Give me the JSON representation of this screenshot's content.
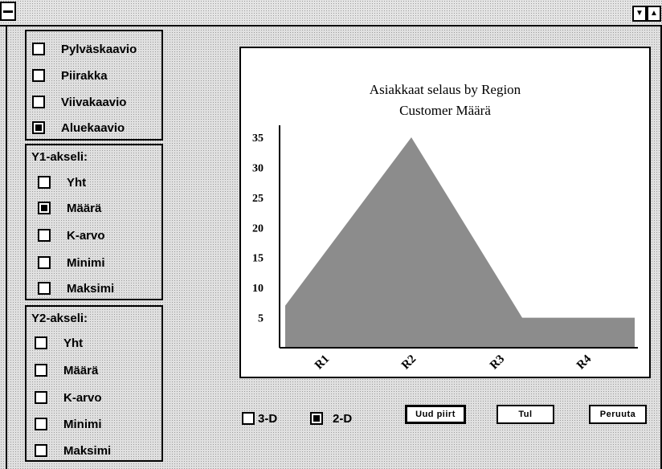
{
  "window": {
    "system_menu": "system-menu",
    "dropdown_glyph": "▼",
    "scroll_up_glyph": "▲"
  },
  "chart_type_group": {
    "options": [
      {
        "label": "Pylväskaavio",
        "checked": false
      },
      {
        "label": "Piirakka",
        "checked": false
      },
      {
        "label": "Viivakaavio",
        "checked": false
      },
      {
        "label": "Aluekaavio",
        "checked": true
      }
    ]
  },
  "y1_group": {
    "title": "Y1-akseli:",
    "options": [
      {
        "label": "Yht",
        "checked": false
      },
      {
        "label": "Määrä",
        "checked": true
      },
      {
        "label": "K-arvo",
        "checked": false
      },
      {
        "label": "Minimi",
        "checked": false
      },
      {
        "label": "Maksimi",
        "checked": false
      }
    ]
  },
  "y2_group": {
    "title": "Y2-akseli:",
    "options": [
      {
        "label": "Yht",
        "checked": false
      },
      {
        "label": "Määrä",
        "checked": false
      },
      {
        "label": "K-arvo",
        "checked": false
      },
      {
        "label": "Minimi",
        "checked": false
      },
      {
        "label": "Maksimi",
        "checked": false
      }
    ]
  },
  "chart_data": {
    "type": "area",
    "title": "Asiakkaat selaus by Region",
    "subtitle": "Customer Määrä",
    "categories": [
      "R1",
      "R2",
      "R3",
      "R4"
    ],
    "series": [
      {
        "values": [
          7,
          35,
          5,
          5
        ]
      }
    ],
    "yticks": [
      5,
      10,
      15,
      20,
      25,
      30,
      35
    ],
    "ylim": [
      0,
      37
    ],
    "fill_color": "#8c8c8c",
    "grid": false
  },
  "view_options": {
    "three_d": {
      "label": "3-D",
      "checked": false
    },
    "two_d": {
      "label": "2-D",
      "checked": true
    }
  },
  "buttons": {
    "redraw": "Uud piirt",
    "print": "Tul",
    "cancel": "Peruuta"
  }
}
